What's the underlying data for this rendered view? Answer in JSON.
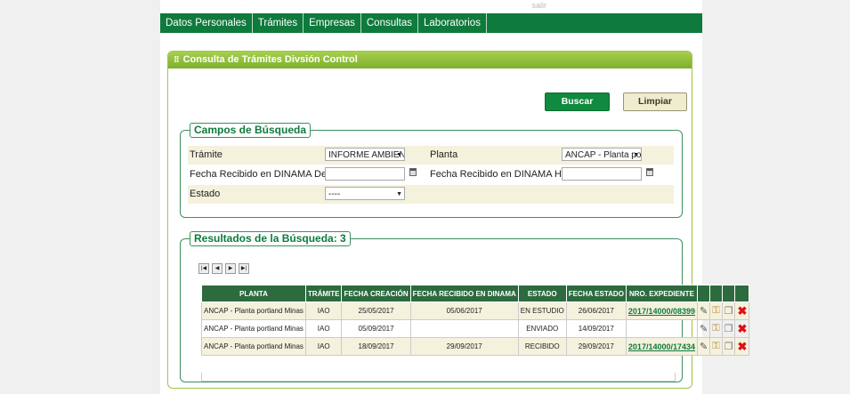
{
  "topmark": "salir",
  "nav": [
    "Datos Personales",
    "Trámites",
    "Empresas",
    "Consultas",
    "Laboratorios"
  ],
  "panel_title": "Consulta de Trámites Divsión Control",
  "buttons": {
    "search": "Buscar",
    "clear": "Limpiar"
  },
  "search": {
    "legend": "Campos de Búsqueda",
    "tramite_label": "Trámite",
    "tramite_value": "INFORME AMBIENTAL",
    "planta_label": "Planta",
    "planta_value": "ANCAP - Planta portland Minas",
    "desde_label": "Fecha Recibido en DINAMA Desde",
    "desde_value": "",
    "hasta_label": "Fecha Recibido en DINAMA Hasta",
    "hasta_value": "",
    "estado_label": "Estado",
    "estado_value": "----"
  },
  "results": {
    "legend": "Resultados de la Búsqueda: 3",
    "headers": [
      "PLANTA",
      "TRÁMITE",
      "FECHA CREACIÓN",
      "FECHA RECIBIDO EN DINAMA",
      "ESTADO",
      "FECHA ESTADO",
      "NRO. EXPEDIENTE"
    ],
    "rows": [
      {
        "planta": "ANCAP - Planta portland Minas",
        "tramite": "IAO",
        "creacion": "25/05/2017",
        "recibido": "05/06/2017",
        "estado": "EN ESTUDIO",
        "fecha_estado": "26/06/2017",
        "expediente": "2017/14000/08399"
      },
      {
        "planta": "ANCAP - Planta portland Minas",
        "tramite": "IAO",
        "creacion": "05/09/2017",
        "recibido": "",
        "estado": "ENVIADO",
        "fecha_estado": "14/09/2017",
        "expediente": ""
      },
      {
        "planta": "ANCAP - Planta portland Minas",
        "tramite": "IAO",
        "creacion": "18/09/2017",
        "recibido": "29/09/2017",
        "estado": "RECIBIDO",
        "fecha_estado": "29/09/2017",
        "expediente": "2017/14000/17434"
      }
    ]
  },
  "icons": {
    "edit": "pencil-icon",
    "key": "key-icon",
    "copy": "copy-icon",
    "delete": "delete-icon"
  },
  "colors": {
    "nav": "#0e7a3c",
    "panel_head": "#8fbd3a",
    "table_head": "#2d6b3f",
    "buscar": "#11893e"
  }
}
